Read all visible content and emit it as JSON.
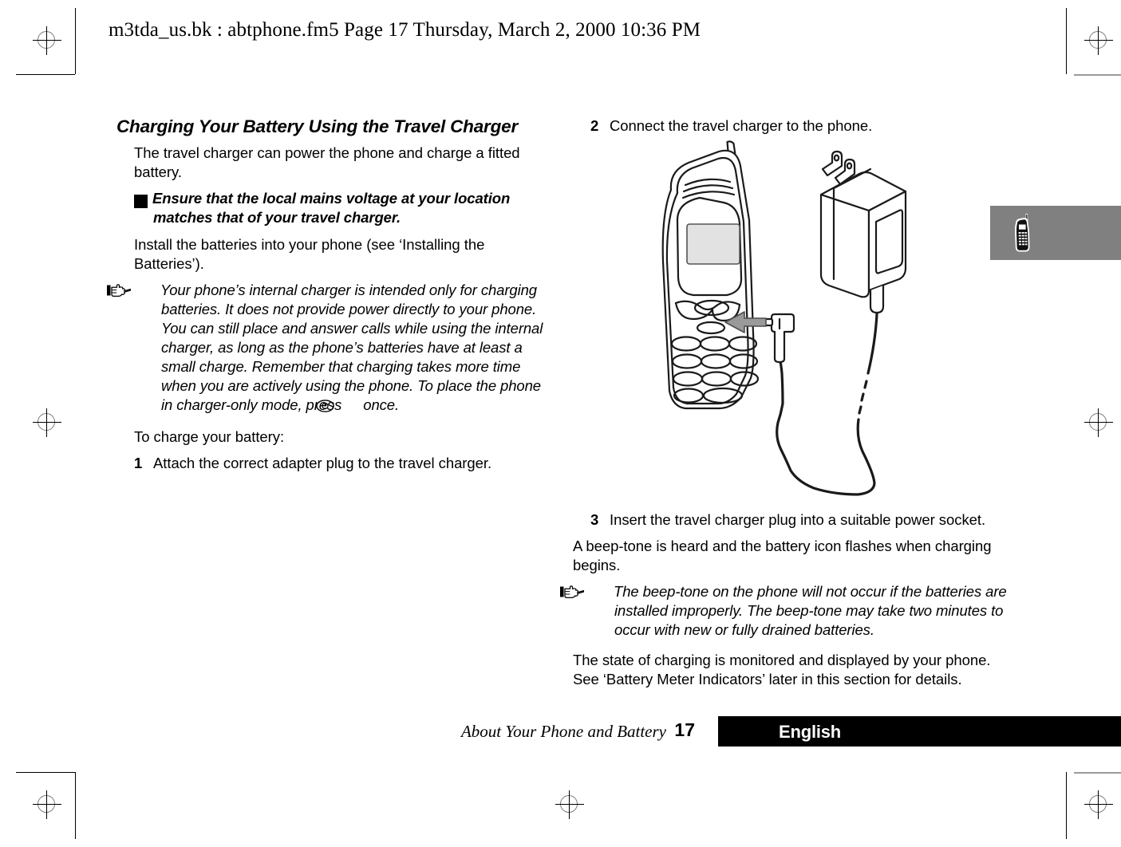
{
  "header": {
    "text": "m3tda_us.bk : abtphone.fm5  Page 17  Thursday, March 2, 2000  10:36 PM"
  },
  "left_column": {
    "section_title": "Charging Your Battery Using the Travel Charger",
    "intro": "The travel charger can power the phone and charge a fitted battery.",
    "warning": {
      "icon": "warning-exclamation-icon",
      "glyph": "!",
      "text": "Ensure that the local mains voltage at your location matches that of your travel charger."
    },
    "install_line": "Install the batteries into your phone (see ‘Installing the Batteries’).",
    "note": {
      "icon": "pointing-hand-icon",
      "text_before": "Your phone’s internal charger is intended only for charging batteries. It does not provide power directly to your phone. You can still place and answer calls while using the internal charger, as long as the phone’s batteries have at least a small charge. Remember that charging takes more time when you are actively using the phone. To place the phone in charger-only mode, press",
      "inline_glyph": "power-key-icon",
      "text_after": "once."
    },
    "to_charge_label": "To charge your battery:",
    "step1": {
      "number": "1",
      "text": "Attach the correct adapter plug to the travel charger."
    }
  },
  "right_column": {
    "step2": {
      "number": "2",
      "text": "Connect the travel charger to the phone."
    },
    "step3": {
      "number": "3",
      "text": "Insert the travel charger plug into a suitable power socket."
    },
    "beep_text": "A beep-tone is heard and the battery icon flashes when charging begins.",
    "note": {
      "icon": "pointing-hand-icon",
      "text": "The beep-tone on the phone will not occur if the batteries are installed improperly. The beep-tone may take two minutes to occur with new or fully drained batteries."
    },
    "state_text": "The state of charging is monitored and displayed by your phone. See ‘Battery Meter Indicators’ later in this section for details."
  },
  "figure": {
    "name": "travel-charger-connection-illustration",
    "elements": [
      "mobile-phone-with-antenna",
      "lcd-screen",
      "earpiece-grille",
      "keypad",
      "ac-travel-charger",
      "charger-plug-prongs",
      "charger-cable",
      "right-angle-connector-plug",
      "direction-arrow"
    ]
  },
  "thumb_tab": {
    "icon": "phone-icon",
    "background_color": "#808080"
  },
  "footer": {
    "title": "About Your Phone and Battery",
    "page_number": "17",
    "language": "English",
    "bar_color": "#000000"
  },
  "print_marks": {
    "registration_icon": "registration-crosshair-icon",
    "crop_icon": "crop-mark-icon"
  }
}
